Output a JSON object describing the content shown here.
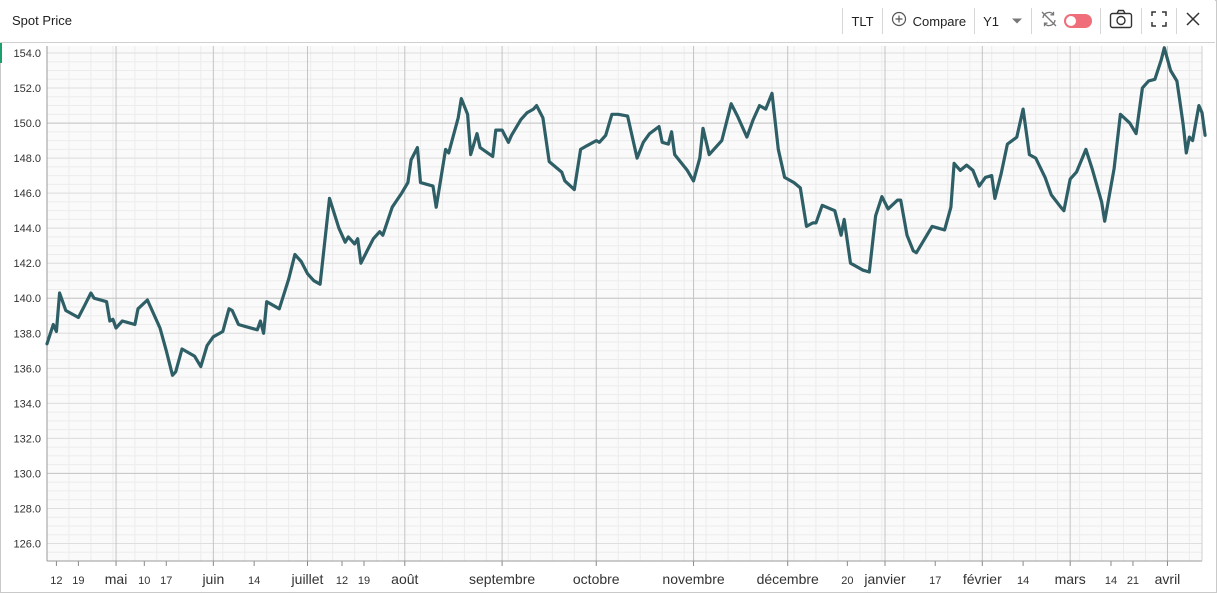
{
  "header": {
    "title": "Spot Price",
    "ticker": "TLT",
    "compare_label": "Compare",
    "period": "Y1"
  },
  "icons": {
    "compare": "plus-circle-icon",
    "dropdown": "chevron-down-icon",
    "sync": "sync-off-icon",
    "toggle": "toggle-icon",
    "camera": "camera-icon",
    "expand": "expand-icon",
    "close": "close-icon"
  },
  "colors": {
    "line": "#2e5f66",
    "toggle": "#f06d7a",
    "accent": "#1aa06d"
  },
  "chart_data": {
    "type": "line",
    "title": "",
    "xlabel": "",
    "ylabel": "",
    "ylim": [
      125,
      154.4
    ],
    "yticks": [
      126.0,
      128.0,
      130.0,
      132.0,
      134.0,
      136.0,
      138.0,
      140.0,
      142.0,
      144.0,
      146.0,
      148.0,
      150.0,
      152.0,
      154.0
    ],
    "xlim": [
      "2021-04-09",
      "2022-04-12"
    ],
    "xtick_labels": [
      {
        "date": "2021-04-12",
        "label": "12",
        "major": false
      },
      {
        "date": "2021-04-19",
        "label": "19",
        "major": false
      },
      {
        "date": "2021-05-01",
        "label": "mai",
        "major": true
      },
      {
        "date": "2021-05-10",
        "label": "10",
        "major": false
      },
      {
        "date": "2021-05-17",
        "label": "17",
        "major": false
      },
      {
        "date": "2021-06-01",
        "label": "juin",
        "major": true
      },
      {
        "date": "2021-06-14",
        "label": "14",
        "major": false
      },
      {
        "date": "2021-07-01",
        "label": "juillet",
        "major": true
      },
      {
        "date": "2021-07-12",
        "label": "12",
        "major": false
      },
      {
        "date": "2021-07-19",
        "label": "19",
        "major": false
      },
      {
        "date": "2021-08-01",
        "label": "août",
        "major": true
      },
      {
        "date": "2021-09-01",
        "label": "septembre",
        "major": true
      },
      {
        "date": "2021-10-01",
        "label": "octobre",
        "major": true
      },
      {
        "date": "2021-11-01",
        "label": "novembre",
        "major": true
      },
      {
        "date": "2021-12-01",
        "label": "décembre",
        "major": true
      },
      {
        "date": "2021-12-20",
        "label": "20",
        "major": false
      },
      {
        "date": "2022-01-01",
        "label": "janvier",
        "major": true
      },
      {
        "date": "2022-01-17",
        "label": "17",
        "major": false
      },
      {
        "date": "2022-02-01",
        "label": "février",
        "major": true
      },
      {
        "date": "2022-02-14",
        "label": "14",
        "major": false
      },
      {
        "date": "2022-03-01",
        "label": "mars",
        "major": true
      },
      {
        "date": "2022-03-14",
        "label": "14",
        "major": false
      },
      {
        "date": "2022-03-21",
        "label": "21",
        "major": false
      },
      {
        "date": "2022-04-01",
        "label": "avril",
        "major": true
      }
    ],
    "grid": true,
    "series": [
      {
        "values": [
          [
            "2021-04-09",
            137.4
          ],
          [
            "2021-04-11",
            138.5
          ],
          [
            "2021-04-12",
            138.1
          ],
          [
            "2021-04-13",
            140.3
          ],
          [
            "2021-04-15",
            139.3
          ],
          [
            "2021-04-19",
            138.9
          ],
          [
            "2021-04-21",
            139.6
          ],
          [
            "2021-04-23",
            140.3
          ],
          [
            "2021-04-24",
            140.0
          ],
          [
            "2021-04-28",
            139.8
          ],
          [
            "2021-04-29",
            138.7
          ],
          [
            "2021-04-30",
            138.8
          ],
          [
            "2021-05-01",
            138.3
          ],
          [
            "2021-05-03",
            138.7
          ],
          [
            "2021-05-07",
            138.5
          ],
          [
            "2021-05-08",
            139.4
          ],
          [
            "2021-05-11",
            139.9
          ],
          [
            "2021-05-15",
            138.3
          ],
          [
            "2021-05-17",
            137.0
          ],
          [
            "2021-05-19",
            135.6
          ],
          [
            "2021-05-20",
            135.8
          ],
          [
            "2021-05-22",
            137.1
          ],
          [
            "2021-05-26",
            136.7
          ],
          [
            "2021-05-28",
            136.1
          ],
          [
            "2021-05-30",
            137.3
          ],
          [
            "2021-06-01",
            137.8
          ],
          [
            "2021-06-04",
            138.1
          ],
          [
            "2021-06-06",
            139.4
          ],
          [
            "2021-06-07",
            139.3
          ],
          [
            "2021-06-09",
            138.5
          ],
          [
            "2021-06-11",
            138.4
          ],
          [
            "2021-06-15",
            138.2
          ],
          [
            "2021-06-16",
            138.7
          ],
          [
            "2021-06-17",
            138.0
          ],
          [
            "2021-06-18",
            139.8
          ],
          [
            "2021-06-22",
            139.4
          ],
          [
            "2021-06-25",
            141.1
          ],
          [
            "2021-06-27",
            142.5
          ],
          [
            "2021-06-29",
            142.1
          ],
          [
            "2021-07-01",
            141.4
          ],
          [
            "2021-07-03",
            141.0
          ],
          [
            "2021-07-05",
            140.8
          ],
          [
            "2021-07-08",
            145.7
          ],
          [
            "2021-07-11",
            144.0
          ],
          [
            "2021-07-13",
            143.2
          ],
          [
            "2021-07-14",
            143.5
          ],
          [
            "2021-07-16",
            143.1
          ],
          [
            "2021-07-17",
            143.4
          ],
          [
            "2021-07-18",
            142.0
          ],
          [
            "2021-07-20",
            142.7
          ],
          [
            "2021-07-22",
            143.4
          ],
          [
            "2021-07-24",
            143.8
          ],
          [
            "2021-07-25",
            143.6
          ],
          [
            "2021-07-28",
            145.2
          ],
          [
            "2021-07-31",
            146.0
          ],
          [
            "2021-08-02",
            146.6
          ],
          [
            "2021-08-03",
            147.9
          ],
          [
            "2021-08-05",
            148.6
          ],
          [
            "2021-08-06",
            146.6
          ],
          [
            "2021-08-10",
            146.4
          ],
          [
            "2021-08-11",
            145.2
          ],
          [
            "2021-08-14",
            148.5
          ],
          [
            "2021-08-15",
            148.3
          ],
          [
            "2021-08-18",
            150.3
          ],
          [
            "2021-08-19",
            151.4
          ],
          [
            "2021-08-21",
            150.5
          ],
          [
            "2021-08-22",
            148.2
          ],
          [
            "2021-08-24",
            149.4
          ],
          [
            "2021-08-25",
            148.6
          ],
          [
            "2021-08-29",
            148.1
          ],
          [
            "2021-08-30",
            149.6
          ],
          [
            "2021-09-01",
            149.6
          ],
          [
            "2021-09-03",
            148.9
          ],
          [
            "2021-09-04",
            149.3
          ],
          [
            "2021-09-07",
            150.2
          ],
          [
            "2021-09-09",
            150.6
          ],
          [
            "2021-09-11",
            150.8
          ],
          [
            "2021-09-12",
            151.0
          ],
          [
            "2021-09-14",
            150.3
          ],
          [
            "2021-09-16",
            147.8
          ],
          [
            "2021-09-20",
            147.2
          ],
          [
            "2021-09-21",
            146.7
          ],
          [
            "2021-09-24",
            146.2
          ],
          [
            "2021-09-26",
            148.5
          ],
          [
            "2021-09-28",
            148.7
          ],
          [
            "2021-10-01",
            149.0
          ],
          [
            "2021-10-02",
            148.9
          ],
          [
            "2021-10-04",
            149.3
          ],
          [
            "2021-10-06",
            150.5
          ],
          [
            "2021-10-08",
            150.5
          ],
          [
            "2021-10-11",
            150.4
          ],
          [
            "2021-10-14",
            148.0
          ],
          [
            "2021-10-16",
            148.9
          ],
          [
            "2021-10-18",
            149.4
          ],
          [
            "2021-10-21",
            149.8
          ],
          [
            "2021-10-22",
            148.9
          ],
          [
            "2021-10-24",
            148.8
          ],
          [
            "2021-10-25",
            149.5
          ],
          [
            "2021-10-26",
            148.2
          ],
          [
            "2021-10-30",
            147.3
          ],
          [
            "2021-11-01",
            146.7
          ],
          [
            "2021-11-03",
            148.0
          ],
          [
            "2021-11-04",
            149.7
          ],
          [
            "2021-11-06",
            148.2
          ],
          [
            "2021-11-10",
            149.0
          ],
          [
            "2021-11-13",
            151.1
          ],
          [
            "2021-11-15",
            150.4
          ],
          [
            "2021-11-18",
            149.2
          ],
          [
            "2021-11-20",
            150.2
          ],
          [
            "2021-11-22",
            151.0
          ],
          [
            "2021-11-24",
            150.8
          ],
          [
            "2021-11-26",
            151.7
          ],
          [
            "2021-11-28",
            148.5
          ],
          [
            "2021-11-30",
            146.9
          ],
          [
            "2021-12-03",
            146.6
          ],
          [
            "2021-12-05",
            146.3
          ],
          [
            "2021-12-07",
            144.1
          ],
          [
            "2021-12-09",
            144.3
          ],
          [
            "2021-12-10",
            144.3
          ],
          [
            "2021-12-12",
            145.3
          ],
          [
            "2021-12-16",
            145.0
          ],
          [
            "2021-12-18",
            143.6
          ],
          [
            "2021-12-19",
            144.5
          ],
          [
            "2021-12-21",
            142.0
          ],
          [
            "2021-12-23",
            141.8
          ],
          [
            "2021-12-25",
            141.6
          ],
          [
            "2021-12-27",
            141.5
          ],
          [
            "2021-12-29",
            144.7
          ],
          [
            "2021-12-31",
            145.8
          ],
          [
            "2022-01-02",
            145.1
          ],
          [
            "2022-01-05",
            145.6
          ],
          [
            "2022-01-06",
            145.6
          ],
          [
            "2022-01-08",
            143.6
          ],
          [
            "2022-01-10",
            142.7
          ],
          [
            "2022-01-11",
            142.6
          ],
          [
            "2022-01-13",
            143.2
          ],
          [
            "2022-01-16",
            144.1
          ],
          [
            "2022-01-18",
            144.0
          ],
          [
            "2022-01-20",
            143.9
          ],
          [
            "2022-01-22",
            145.2
          ],
          [
            "2022-01-23",
            147.7
          ],
          [
            "2022-01-25",
            147.3
          ],
          [
            "2022-01-27",
            147.6
          ],
          [
            "2022-01-29",
            147.3
          ],
          [
            "2022-01-31",
            146.4
          ],
          [
            "2022-02-02",
            146.9
          ],
          [
            "2022-02-04",
            147.0
          ],
          [
            "2022-02-05",
            145.7
          ],
          [
            "2022-02-07",
            147.1
          ],
          [
            "2022-02-09",
            148.8
          ],
          [
            "2022-02-12",
            149.2
          ],
          [
            "2022-02-14",
            150.8
          ],
          [
            "2022-02-16",
            148.2
          ],
          [
            "2022-02-18",
            148.0
          ],
          [
            "2022-02-21",
            146.9
          ],
          [
            "2022-02-23",
            145.9
          ],
          [
            "2022-02-26",
            145.2
          ],
          [
            "2022-02-27",
            145.0
          ],
          [
            "2022-03-01",
            146.8
          ],
          [
            "2022-03-03",
            147.2
          ],
          [
            "2022-03-06",
            148.5
          ],
          [
            "2022-03-08",
            147.4
          ],
          [
            "2022-03-11",
            145.5
          ],
          [
            "2022-03-12",
            144.4
          ],
          [
            "2022-03-15",
            147.4
          ],
          [
            "2022-03-17",
            150.5
          ],
          [
            "2022-03-20",
            150.0
          ],
          [
            "2022-03-22",
            149.4
          ],
          [
            "2022-03-24",
            152.0
          ],
          [
            "2022-03-26",
            152.4
          ],
          [
            "2022-03-28",
            152.5
          ],
          [
            "2022-03-30",
            153.6
          ],
          [
            "2022-03-31",
            154.3
          ],
          [
            "2022-04-02",
            153.0
          ],
          [
            "2022-04-04",
            152.4
          ],
          [
            "2022-04-05",
            151.2
          ],
          [
            "2022-04-06",
            149.9
          ],
          [
            "2022-04-07",
            148.3
          ],
          [
            "2022-04-08",
            149.2
          ],
          [
            "2022-04-09",
            149.0
          ],
          [
            "2022-04-10",
            150.0
          ],
          [
            "2022-04-11",
            151.0
          ],
          [
            "2022-04-12",
            150.6
          ],
          [
            "2022-04-13",
            149.3
          ]
        ]
      }
    ]
  }
}
